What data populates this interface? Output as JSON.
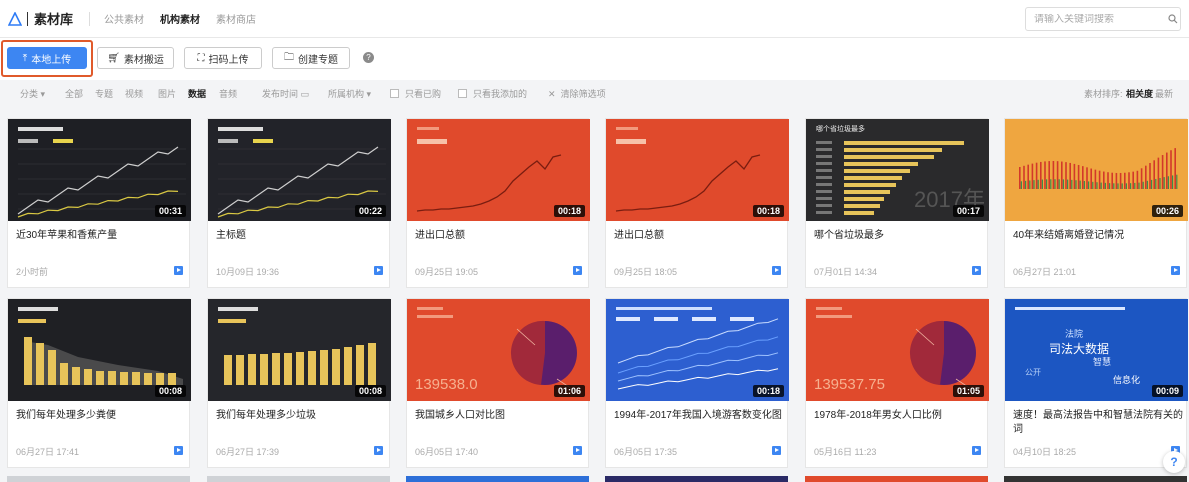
{
  "app": {
    "title": "素材库"
  },
  "nav": {
    "public": "公共素材",
    "org": "机构素材",
    "store": "素材商店"
  },
  "search": {
    "placeholder": "请输入关键词搜索",
    "value": ""
  },
  "actions": {
    "upload": "本地上传",
    "move": "素材搬运",
    "scan": "扫码上传",
    "topic": "创建专题",
    "help": "?"
  },
  "filters": {
    "category": "分类",
    "all": "全部",
    "topic": "专题",
    "video": "视频",
    "image": "图片",
    "data": "数据",
    "audio": "音频",
    "publish_time": "发布时间",
    "org": "所属机构",
    "viewed": "只看已购",
    "mine": "只看我添加的",
    "clear": "清除筛选项",
    "sort_label": "素材排序:",
    "sort_relevance": "相关度",
    "sort_latest": "最新"
  },
  "cards": [
    {
      "title": "近30年苹果和香蕉产量",
      "date": "2小时前",
      "duration": "00:31",
      "thumb": "dark-line"
    },
    {
      "title": "主标题",
      "date": "10月09日 19:36",
      "duration": "00:22",
      "thumb": "dark-line2"
    },
    {
      "title": "进出口总额",
      "date": "09月25日 19:05",
      "duration": "00:18",
      "thumb": "red-line"
    },
    {
      "title": "进出口总额",
      "date": "09月25日 18:05",
      "duration": "00:18",
      "thumb": "red-line"
    },
    {
      "title": "哪个省垃圾最多",
      "date": "07月01日 14:34",
      "duration": "00:17",
      "thumb": "dark-hbar",
      "big_text": "2017年",
      "chart_title": "哪个省垃圾最多"
    },
    {
      "title": "40年来结婚离婚登记情况",
      "date": "06月27日 21:01",
      "duration": "00:26",
      "thumb": "orange-bars"
    },
    {
      "title": "我们每年处理多少粪便",
      "date": "06月27日 17:41",
      "duration": "00:08",
      "thumb": "dark-ybar"
    },
    {
      "title": "我们每年处理多少垃圾",
      "date": "06月27日 17:39",
      "duration": "00:08",
      "thumb": "dark-ybar2"
    },
    {
      "title": "我国城乡人口对比图",
      "date": "06月05日 17:40",
      "duration": "01:06",
      "thumb": "red-pie",
      "big_text": "139538.0"
    },
    {
      "title": "1994年-2017年我国入境游客数变化图",
      "date": "06月05日 17:35",
      "duration": "00:18",
      "thumb": "blue-line"
    },
    {
      "title": "1978年-2018年男女人口比例",
      "date": "05月16日 11:23",
      "duration": "01:05",
      "thumb": "red-pie",
      "big_text": "139537.75"
    },
    {
      "title": "速度！最高法报告中和智慧法院有关的词",
      "date": "04月10日 18:25",
      "duration": "00:09",
      "thumb": "blue-words",
      "words": [
        "法院",
        "司法大数据",
        "智慧",
        "公开",
        "信息化"
      ]
    }
  ],
  "colors": {
    "primary": "#3d86f2",
    "highlight": "#e05a2b",
    "dark_thumb": "#1e1f24",
    "red_thumb": "#e04a2c",
    "orange_thumb": "#efa640"
  }
}
